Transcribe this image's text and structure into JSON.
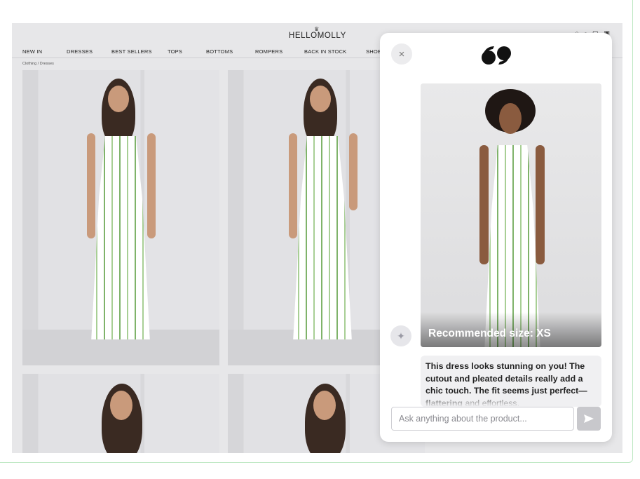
{
  "site": {
    "logo": "HELLOMOLLY",
    "logo_crown": "♛",
    "nav": [
      "NEW IN",
      "DRESSES",
      "BEST SELLERS",
      "TOPS",
      "BOTTOMS",
      "ROMPERS",
      "BACK IN STOCK",
      "SHOE"
    ],
    "breadcrumb": "Clothing / Dresses"
  },
  "panel": {
    "close_icon": "×",
    "recommended_size": "Recommended size: XS",
    "ai_icon": "✦",
    "message_bold": "This dress looks stunning on you! The cutout and pleated details really add a chic touch. The fit seems just perfect—flattering",
    "message_rest": " and effortless.",
    "input_placeholder": "Ask anything about the product...",
    "send_icon": "➤"
  }
}
